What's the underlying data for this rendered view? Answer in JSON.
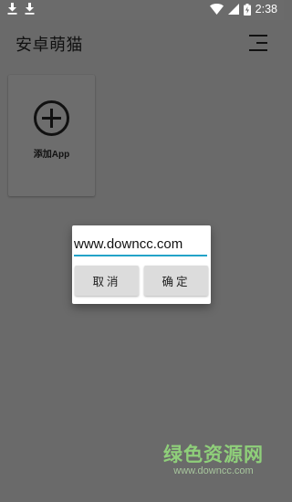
{
  "status_bar": {
    "time": "2:38",
    "left_icons": [
      "download-icon",
      "download-icon"
    ],
    "right_icons": [
      "wifi-icon",
      "signal-icon",
      "battery-icon"
    ]
  },
  "app_bar": {
    "title": "安卓萌猫",
    "menu_icon": "menu-icon"
  },
  "add_card": {
    "icon": "add-circle-icon",
    "label": "添加App"
  },
  "dialog": {
    "input_value": "www.downcc.com",
    "cancel_label": "取消",
    "ok_label": "确定",
    "accent_color": "#23a3c8"
  },
  "watermark": {
    "title": "绿色资源网",
    "url": "www.downcc.com"
  }
}
